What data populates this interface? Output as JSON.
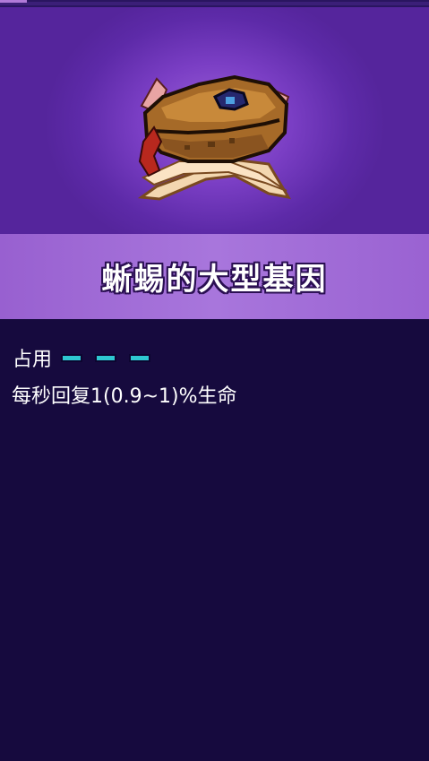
{
  "item": {
    "name": "蜥蜴的大型基因",
    "icon": "lizard-head-icon"
  },
  "slots": {
    "label": "占用",
    "count": 3,
    "color": "#2ec8d0"
  },
  "effect": "每秒回复1(0.9~1)%生命",
  "colors": {
    "hero_background": "#7a3ec4",
    "title_band": "#a876dc",
    "panel_background": "#160a3e"
  }
}
